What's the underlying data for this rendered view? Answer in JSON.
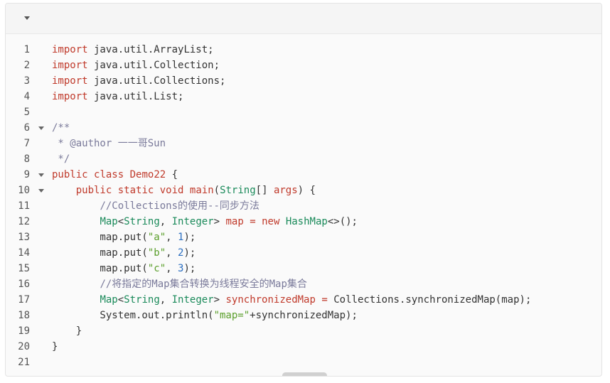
{
  "lines": [
    {
      "n": "1",
      "fold": false,
      "tokens": [
        [
          "kw",
          "import"
        ],
        [
          "plain",
          " java.util."
        ],
        [
          "func",
          "ArrayList"
        ],
        [
          "plain",
          ";"
        ]
      ]
    },
    {
      "n": "2",
      "fold": false,
      "tokens": [
        [
          "kw",
          "import"
        ],
        [
          "plain",
          " java.util."
        ],
        [
          "func",
          "Collection"
        ],
        [
          "plain",
          ";"
        ]
      ]
    },
    {
      "n": "3",
      "fold": false,
      "tokens": [
        [
          "kw",
          "import"
        ],
        [
          "plain",
          " java.util."
        ],
        [
          "func",
          "Collections"
        ],
        [
          "plain",
          ";"
        ]
      ]
    },
    {
      "n": "4",
      "fold": false,
      "tokens": [
        [
          "kw",
          "import"
        ],
        [
          "plain",
          " java.util."
        ],
        [
          "func",
          "List"
        ],
        [
          "plain",
          ";"
        ]
      ]
    },
    {
      "n": "5",
      "fold": false,
      "tokens": []
    },
    {
      "n": "6",
      "fold": true,
      "tokens": [
        [
          "cmt",
          "/**"
        ]
      ]
    },
    {
      "n": "7",
      "fold": false,
      "tokens": [
        [
          "cmt",
          " * @author 一一哥Sun"
        ]
      ]
    },
    {
      "n": "8",
      "fold": false,
      "tokens": [
        [
          "cmt",
          " */"
        ]
      ]
    },
    {
      "n": "9",
      "fold": true,
      "tokens": [
        [
          "kw",
          "public"
        ],
        [
          "plain",
          " "
        ],
        [
          "kw",
          "class"
        ],
        [
          "plain",
          " "
        ],
        [
          "cls",
          "Demo22"
        ],
        [
          "plain",
          " {"
        ]
      ]
    },
    {
      "n": "10",
      "fold": true,
      "tokens": [
        [
          "plain",
          "    "
        ],
        [
          "kw",
          "public"
        ],
        [
          "plain",
          " "
        ],
        [
          "kw",
          "static"
        ],
        [
          "plain",
          " "
        ],
        [
          "kw",
          "void"
        ],
        [
          "plain",
          " "
        ],
        [
          "cls",
          "main"
        ],
        [
          "plain",
          "("
        ],
        [
          "type",
          "String"
        ],
        [
          "plain",
          "[] "
        ],
        [
          "var",
          "args"
        ],
        [
          "plain",
          ") {"
        ]
      ]
    },
    {
      "n": "11",
      "fold": false,
      "tokens": [
        [
          "plain",
          "        "
        ],
        [
          "cmt",
          "//Collections的使用--同步方法"
        ]
      ]
    },
    {
      "n": "12",
      "fold": false,
      "tokens": [
        [
          "plain",
          "        "
        ],
        [
          "type",
          "Map"
        ],
        [
          "plain",
          "<"
        ],
        [
          "type",
          "String"
        ],
        [
          "plain",
          ", "
        ],
        [
          "type",
          "Integer"
        ],
        [
          "plain",
          "> "
        ],
        [
          "var",
          "map"
        ],
        [
          "plain",
          " "
        ],
        [
          "kw",
          "="
        ],
        [
          "plain",
          " "
        ],
        [
          "kw",
          "new"
        ],
        [
          "plain",
          " "
        ],
        [
          "type",
          "HashMap"
        ],
        [
          "plain",
          "<>();"
        ]
      ]
    },
    {
      "n": "13",
      "fold": false,
      "tokens": [
        [
          "plain",
          "        map.put("
        ],
        [
          "str",
          "\"a\""
        ],
        [
          "plain",
          ", "
        ],
        [
          "num",
          "1"
        ],
        [
          "plain",
          ");"
        ]
      ]
    },
    {
      "n": "14",
      "fold": false,
      "tokens": [
        [
          "plain",
          "        map.put("
        ],
        [
          "str",
          "\"b\""
        ],
        [
          "plain",
          ", "
        ],
        [
          "num",
          "2"
        ],
        [
          "plain",
          ");"
        ]
      ]
    },
    {
      "n": "15",
      "fold": false,
      "tokens": [
        [
          "plain",
          "        map.put("
        ],
        [
          "str",
          "\"c\""
        ],
        [
          "plain",
          ", "
        ],
        [
          "num",
          "3"
        ],
        [
          "plain",
          ");"
        ]
      ]
    },
    {
      "n": "16",
      "fold": false,
      "tokens": [
        [
          "plain",
          "        "
        ],
        [
          "cmt",
          "//将指定的Map集合转换为线程安全的Map集合"
        ]
      ]
    },
    {
      "n": "17",
      "fold": false,
      "tokens": [
        [
          "plain",
          "        "
        ],
        [
          "type",
          "Map"
        ],
        [
          "plain",
          "<"
        ],
        [
          "type",
          "String"
        ],
        [
          "plain",
          ", "
        ],
        [
          "type",
          "Integer"
        ],
        [
          "plain",
          "> "
        ],
        [
          "var",
          "synchronizedMap"
        ],
        [
          "plain",
          " "
        ],
        [
          "kw",
          "="
        ],
        [
          "plain",
          " Collections.synchronizedMap(map);"
        ]
      ]
    },
    {
      "n": "18",
      "fold": false,
      "tokens": [
        [
          "plain",
          "        System.out.println("
        ],
        [
          "str",
          "\"map=\""
        ],
        [
          "plain",
          "+synchronizedMap);"
        ]
      ]
    },
    {
      "n": "19",
      "fold": false,
      "tokens": [
        [
          "plain",
          "    }"
        ]
      ]
    },
    {
      "n": "20",
      "fold": false,
      "tokens": [
        [
          "plain",
          "}"
        ]
      ]
    },
    {
      "n": "21",
      "fold": false,
      "tokens": []
    }
  ],
  "colors": {
    "keyword": "#c03a2b",
    "type": "#1a8a5a",
    "string": "#5a9e2a",
    "number": "#2a6ec0",
    "comment": "#7a7a9a"
  }
}
